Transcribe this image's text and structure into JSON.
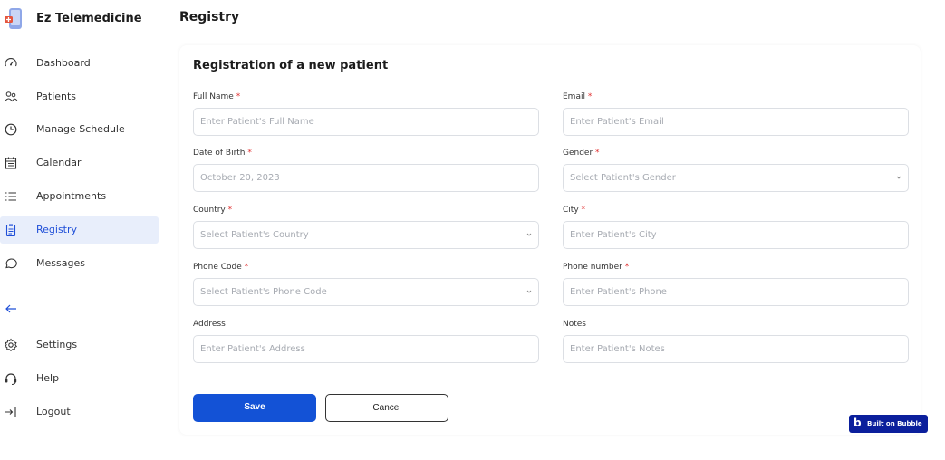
{
  "app": {
    "name": "Ez Telemedicine"
  },
  "sidebar": {
    "items": [
      {
        "label": "Dashboard",
        "icon": "dashboard-icon"
      },
      {
        "label": "Patients",
        "icon": "patients-icon"
      },
      {
        "label": "Manage Schedule",
        "icon": "clock-icon"
      },
      {
        "label": "Calendar",
        "icon": "calendar-icon"
      },
      {
        "label": "Appointments",
        "icon": "list-icon"
      },
      {
        "label": "Registry",
        "icon": "clipboard-icon",
        "active": true
      },
      {
        "label": "Messages",
        "icon": "chat-icon"
      },
      {
        "label": "Settings",
        "icon": "gear-icon"
      },
      {
        "label": "Help",
        "icon": "headset-icon"
      },
      {
        "label": "Logout",
        "icon": "logout-icon"
      }
    ]
  },
  "page": {
    "title": "Registry"
  },
  "form": {
    "title": "Registration of a new patient",
    "full_name": {
      "label": "Full Name",
      "required": "*",
      "placeholder": "Enter Patient's Full Name"
    },
    "email": {
      "label": "Email",
      "required": "*",
      "placeholder": "Enter Patient's Email"
    },
    "dob": {
      "label": "Date of Birth",
      "required": "*",
      "value": "October 20, 2023"
    },
    "gender": {
      "label": "Gender",
      "required": "*",
      "placeholder": "Select Patient's Gender"
    },
    "country": {
      "label": "Country",
      "required": "*",
      "placeholder": "Select Patient's Country"
    },
    "city": {
      "label": "City",
      "required": "*",
      "placeholder": "Enter Patient's City"
    },
    "phone_code": {
      "label": "Phone Code",
      "required": "*",
      "placeholder": "Select Patient's Phone Code"
    },
    "phone_number": {
      "label": "Phone number",
      "required": "*",
      "placeholder": "Enter Patient's Phone"
    },
    "address": {
      "label": "Address",
      "placeholder": "Enter Patient's Address"
    },
    "notes": {
      "label": "Notes",
      "placeholder": "Enter Patient's Notes"
    },
    "save_label": "Save",
    "cancel_label": "Cancel"
  },
  "badge": {
    "text": "Built on Bubble",
    "logo": "b"
  },
  "colors": {
    "primary": "#1352d6",
    "active_bg": "#e8eefb",
    "required": "#e03131",
    "badge_bg": "#0b1f9c"
  }
}
